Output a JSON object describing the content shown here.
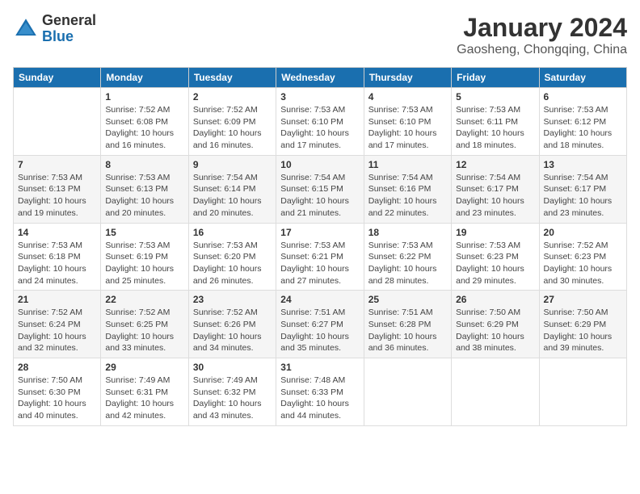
{
  "header": {
    "logo_general": "General",
    "logo_blue": "Blue",
    "month_year": "January 2024",
    "location": "Gaosheng, Chongqing, China"
  },
  "days_of_week": [
    "Sunday",
    "Monday",
    "Tuesday",
    "Wednesday",
    "Thursday",
    "Friday",
    "Saturday"
  ],
  "weeks": [
    [
      {
        "day": "",
        "info": ""
      },
      {
        "day": "1",
        "info": "Sunrise: 7:52 AM\nSunset: 6:08 PM\nDaylight: 10 hours\nand 16 minutes."
      },
      {
        "day": "2",
        "info": "Sunrise: 7:52 AM\nSunset: 6:09 PM\nDaylight: 10 hours\nand 16 minutes."
      },
      {
        "day": "3",
        "info": "Sunrise: 7:53 AM\nSunset: 6:10 PM\nDaylight: 10 hours\nand 17 minutes."
      },
      {
        "day": "4",
        "info": "Sunrise: 7:53 AM\nSunset: 6:10 PM\nDaylight: 10 hours\nand 17 minutes."
      },
      {
        "day": "5",
        "info": "Sunrise: 7:53 AM\nSunset: 6:11 PM\nDaylight: 10 hours\nand 18 minutes."
      },
      {
        "day": "6",
        "info": "Sunrise: 7:53 AM\nSunset: 6:12 PM\nDaylight: 10 hours\nand 18 minutes."
      }
    ],
    [
      {
        "day": "7",
        "info": "Sunrise: 7:53 AM\nSunset: 6:13 PM\nDaylight: 10 hours\nand 19 minutes."
      },
      {
        "day": "8",
        "info": "Sunrise: 7:53 AM\nSunset: 6:13 PM\nDaylight: 10 hours\nand 20 minutes."
      },
      {
        "day": "9",
        "info": "Sunrise: 7:54 AM\nSunset: 6:14 PM\nDaylight: 10 hours\nand 20 minutes."
      },
      {
        "day": "10",
        "info": "Sunrise: 7:54 AM\nSunset: 6:15 PM\nDaylight: 10 hours\nand 21 minutes."
      },
      {
        "day": "11",
        "info": "Sunrise: 7:54 AM\nSunset: 6:16 PM\nDaylight: 10 hours\nand 22 minutes."
      },
      {
        "day": "12",
        "info": "Sunrise: 7:54 AM\nSunset: 6:17 PM\nDaylight: 10 hours\nand 23 minutes."
      },
      {
        "day": "13",
        "info": "Sunrise: 7:54 AM\nSunset: 6:17 PM\nDaylight: 10 hours\nand 23 minutes."
      }
    ],
    [
      {
        "day": "14",
        "info": "Sunrise: 7:53 AM\nSunset: 6:18 PM\nDaylight: 10 hours\nand 24 minutes."
      },
      {
        "day": "15",
        "info": "Sunrise: 7:53 AM\nSunset: 6:19 PM\nDaylight: 10 hours\nand 25 minutes."
      },
      {
        "day": "16",
        "info": "Sunrise: 7:53 AM\nSunset: 6:20 PM\nDaylight: 10 hours\nand 26 minutes."
      },
      {
        "day": "17",
        "info": "Sunrise: 7:53 AM\nSunset: 6:21 PM\nDaylight: 10 hours\nand 27 minutes."
      },
      {
        "day": "18",
        "info": "Sunrise: 7:53 AM\nSunset: 6:22 PM\nDaylight: 10 hours\nand 28 minutes."
      },
      {
        "day": "19",
        "info": "Sunrise: 7:53 AM\nSunset: 6:23 PM\nDaylight: 10 hours\nand 29 minutes."
      },
      {
        "day": "20",
        "info": "Sunrise: 7:52 AM\nSunset: 6:23 PM\nDaylight: 10 hours\nand 30 minutes."
      }
    ],
    [
      {
        "day": "21",
        "info": "Sunrise: 7:52 AM\nSunset: 6:24 PM\nDaylight: 10 hours\nand 32 minutes."
      },
      {
        "day": "22",
        "info": "Sunrise: 7:52 AM\nSunset: 6:25 PM\nDaylight: 10 hours\nand 33 minutes."
      },
      {
        "day": "23",
        "info": "Sunrise: 7:52 AM\nSunset: 6:26 PM\nDaylight: 10 hours\nand 34 minutes."
      },
      {
        "day": "24",
        "info": "Sunrise: 7:51 AM\nSunset: 6:27 PM\nDaylight: 10 hours\nand 35 minutes."
      },
      {
        "day": "25",
        "info": "Sunrise: 7:51 AM\nSunset: 6:28 PM\nDaylight: 10 hours\nand 36 minutes."
      },
      {
        "day": "26",
        "info": "Sunrise: 7:50 AM\nSunset: 6:29 PM\nDaylight: 10 hours\nand 38 minutes."
      },
      {
        "day": "27",
        "info": "Sunrise: 7:50 AM\nSunset: 6:29 PM\nDaylight: 10 hours\nand 39 minutes."
      }
    ],
    [
      {
        "day": "28",
        "info": "Sunrise: 7:50 AM\nSunset: 6:30 PM\nDaylight: 10 hours\nand 40 minutes."
      },
      {
        "day": "29",
        "info": "Sunrise: 7:49 AM\nSunset: 6:31 PM\nDaylight: 10 hours\nand 42 minutes."
      },
      {
        "day": "30",
        "info": "Sunrise: 7:49 AM\nSunset: 6:32 PM\nDaylight: 10 hours\nand 43 minutes."
      },
      {
        "day": "31",
        "info": "Sunrise: 7:48 AM\nSunset: 6:33 PM\nDaylight: 10 hours\nand 44 minutes."
      },
      {
        "day": "",
        "info": ""
      },
      {
        "day": "",
        "info": ""
      },
      {
        "day": "",
        "info": ""
      }
    ]
  ]
}
